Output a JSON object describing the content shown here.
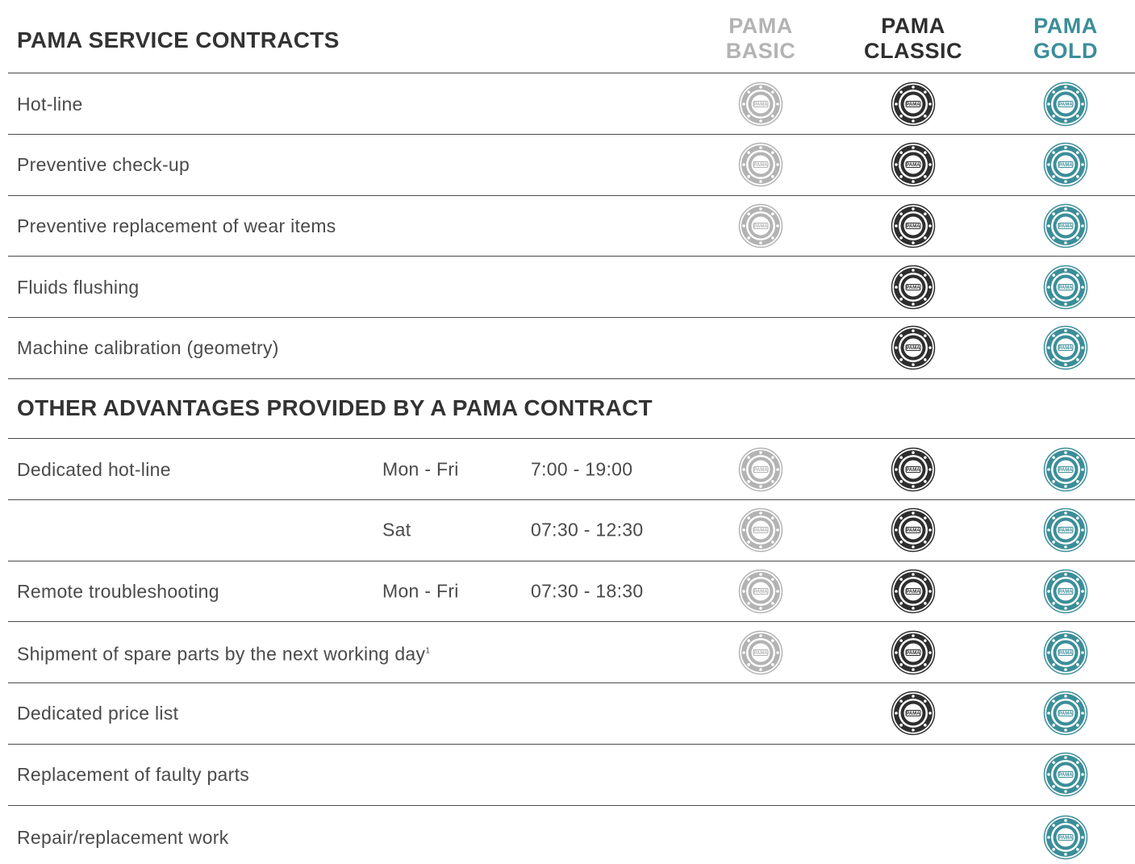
{
  "header": {
    "title": "PAMA SERVICE CONTRACTS",
    "columns": [
      {
        "line1": "PAMA",
        "line2": "BASIC"
      },
      {
        "line1": "PAMA",
        "line2": "CLASSIC"
      },
      {
        "line1": "PAMA",
        "line2": "GOLD"
      }
    ]
  },
  "badge_text": "PAMA",
  "colors": {
    "basic": "#b3b3b3",
    "classic": "#2e2e2e",
    "gold": "#3b8e99"
  },
  "section1": {
    "rows": [
      {
        "label": "Hot-line",
        "basic": true,
        "classic": true,
        "gold": true
      },
      {
        "label": "Preventive check-up",
        "basic": true,
        "classic": true,
        "gold": true
      },
      {
        "label": "Preventive replacement of wear items",
        "basic": true,
        "classic": true,
        "gold": true
      },
      {
        "label": "Fluids flushing",
        "basic": false,
        "classic": true,
        "gold": true
      },
      {
        "label": "Machine calibration (geometry)",
        "basic": false,
        "classic": true,
        "gold": true
      }
    ]
  },
  "section2": {
    "title": "OTHER ADVANTAGES PROVIDED BY A PAMA CONTRACT",
    "rows": [
      {
        "label": "Dedicated hot-line",
        "day": "Mon - Fri",
        "hours": "7:00 - 19:00",
        "basic": true,
        "classic": true,
        "gold": true
      },
      {
        "label": "",
        "day": "Sat",
        "hours": "07:30 - 12:30",
        "basic": true,
        "classic": true,
        "gold": true
      },
      {
        "label": "Remote troubleshooting",
        "day": "Mon - Fri",
        "hours": "07:30 - 18:30",
        "basic": true,
        "classic": true,
        "gold": true
      },
      {
        "label": "Shipment of spare parts by the next working day",
        "footnote": "1",
        "day": "",
        "hours": "",
        "basic": true,
        "classic": true,
        "gold": true
      },
      {
        "label": "Dedicated price list",
        "day": "",
        "hours": "",
        "basic": false,
        "classic": true,
        "gold": true
      },
      {
        "label": "Replacement of faulty parts",
        "day": "",
        "hours": "",
        "basic": false,
        "classic": false,
        "gold": true
      },
      {
        "label": "Repair/replacement work",
        "day": "",
        "hours": "",
        "basic": false,
        "classic": false,
        "gold": true
      }
    ]
  }
}
